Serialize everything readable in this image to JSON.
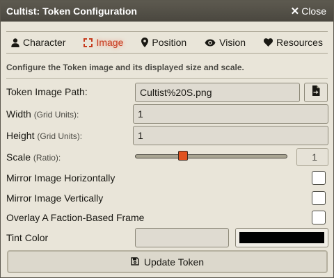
{
  "window": {
    "title": "Cultist: Token Configuration",
    "close_label": "Close"
  },
  "tabs": [
    {
      "label": "Character",
      "icon": "user-icon",
      "active": false
    },
    {
      "label": "Image",
      "icon": "expand-icon",
      "active": true
    },
    {
      "label": "Position",
      "icon": "map-marker-icon",
      "active": false
    },
    {
      "label": "Vision",
      "icon": "eye-icon",
      "active": false
    },
    {
      "label": "Resources",
      "icon": "heart-icon",
      "active": false
    }
  ],
  "notes": "Configure the Token image and its displayed size and scale.",
  "form": {
    "image_path": {
      "label": "Token Image Path:",
      "value": "Cultist%20S.png",
      "button_icon": "file-import-icon"
    },
    "width": {
      "label": "Width",
      "units": "(Grid Units):",
      "value": "1"
    },
    "height": {
      "label": "Height",
      "units": "(Grid Units):",
      "value": "1"
    },
    "scale": {
      "label": "Scale",
      "units": "(Ratio):",
      "value": "1",
      "slider_fraction": 0.3
    },
    "mirror_x": {
      "label": "Mirror Image Horizontally",
      "checked": false
    },
    "mirror_y": {
      "label": "Mirror Image Vertically",
      "checked": false
    },
    "overlay_frame": {
      "label": "Overlay A Faction-Based Frame",
      "checked": false
    },
    "tint": {
      "label": "Tint Color",
      "value": "",
      "swatch_color": "#000000"
    }
  },
  "submit": {
    "label": "Update Token",
    "icon": "save-icon"
  },
  "colors": {
    "active_tab": "#c63a1d",
    "slider_thumb": "#e0521f",
    "titlebar": "#4f4c44"
  }
}
